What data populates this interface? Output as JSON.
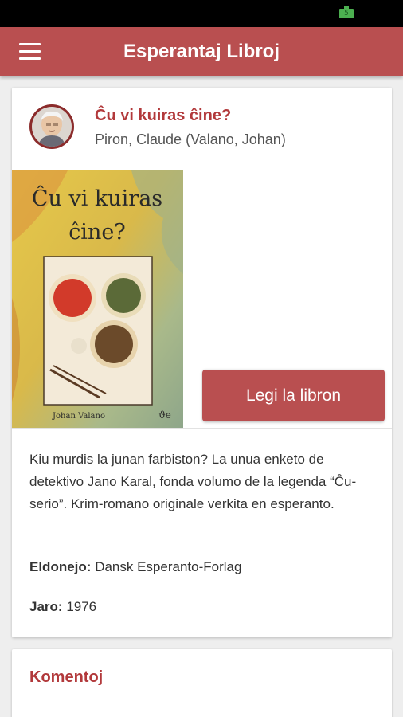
{
  "status_bar": {
    "battery_level": "5"
  },
  "app_bar": {
    "title": "Esperantaj Libroj"
  },
  "book": {
    "title": "Ĉu vi kuiras ĉine?",
    "author": "Piron, Claude (Valano, Johan)",
    "cover": {
      "title_line1": "Ĉu vi kuiras",
      "title_line2": "ĉine?",
      "author": "Johan Valano"
    },
    "read_button_label": "Legi la libron",
    "description": "Kiu murdis la junan farbiston? La unua enketo de detektivo Jano Karal, fonda volumo de la legenda “Ĉu-serio”. Krim-romano originale verkita en esperanto.",
    "publisher_label": "Eldonejo:",
    "publisher": "Dansk Esperanto-Forlag",
    "year_label": "Jaro:",
    "year": "1976"
  },
  "comments": {
    "title": "Komentoj"
  },
  "colors": {
    "accent": "#b94f50",
    "title_red": "#b2393b"
  }
}
